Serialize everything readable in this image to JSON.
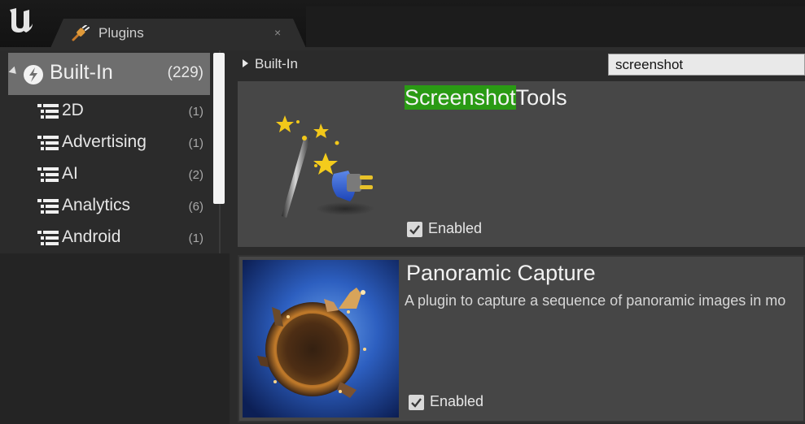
{
  "window": {
    "logo_text": "U",
    "tab": {
      "label": "Plugins",
      "icon": "plug-icon",
      "close_glyph": "×"
    }
  },
  "sidebar": {
    "root": {
      "label": "Built-In",
      "count": "(229)",
      "icon": "unreal-category-icon"
    },
    "items": [
      {
        "label": "2D",
        "count": "(1)"
      },
      {
        "label": "Advertising",
        "count": "(1)"
      },
      {
        "label": "AI",
        "count": "(2)"
      },
      {
        "label": "Analytics",
        "count": "(6)"
      },
      {
        "label": "Android",
        "count": "(1)"
      }
    ]
  },
  "breadcrumb": {
    "label": "Built-In"
  },
  "search": {
    "value": "screenshot"
  },
  "plugins": [
    {
      "title_highlight": "Screenshot",
      "title_rest": "Tools",
      "description": "",
      "enabled_label": "Enabled",
      "enabled": true,
      "thumbnail": "magic-wand-plug-icon"
    },
    {
      "title_highlight": "",
      "title_rest": "Panoramic Capture",
      "description": "A plugin to capture a sequence of panoramic images in mo",
      "enabled_label": "Enabled",
      "enabled": true,
      "thumbnail": "tiny-planet-image"
    }
  ],
  "colors": {
    "highlight": "#2a9a14",
    "selected_row": "#6e6e6e",
    "panel": "#2b2b2b",
    "card": "#474747"
  }
}
